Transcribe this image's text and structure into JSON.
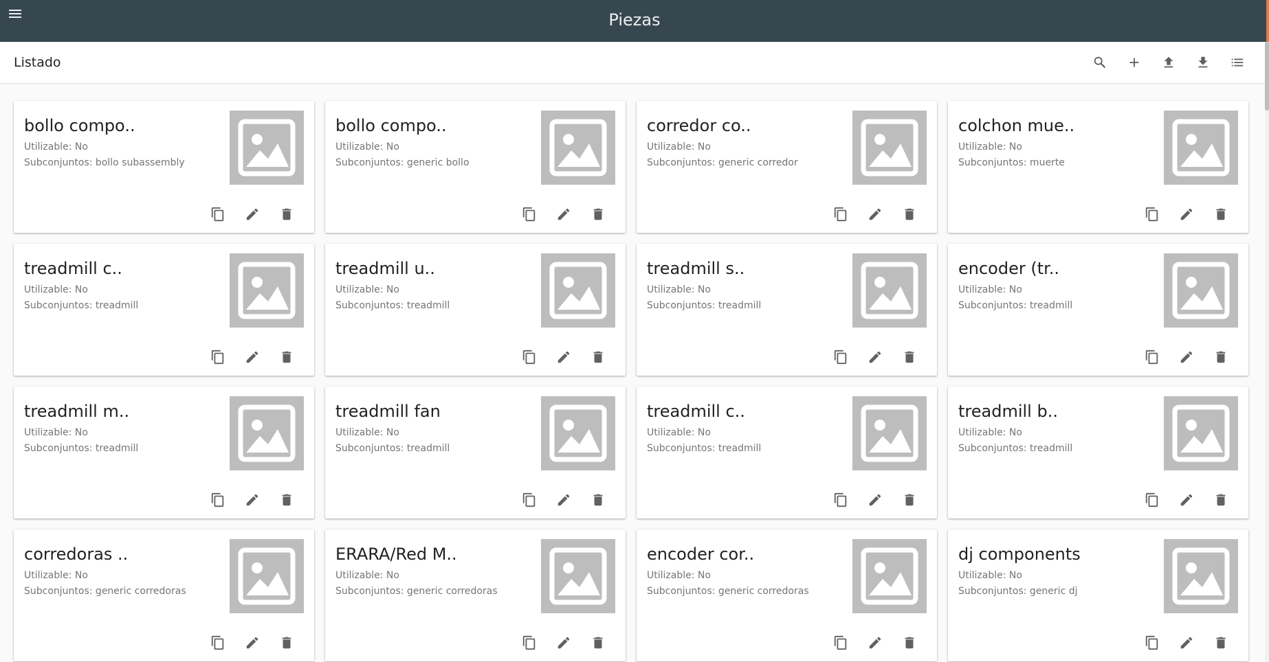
{
  "header": {
    "title": "Piezas",
    "menu_icon": "menu-icon"
  },
  "toolbar": {
    "title": "Listado",
    "actions": [
      "search-icon",
      "add-icon",
      "upload-icon",
      "download-icon",
      "list-icon"
    ]
  },
  "colors": {
    "header_bg": "#37474f",
    "accent": "#e07a4f",
    "placeholder": "#bdbdbd"
  },
  "cards": [
    {
      "title": "bollo compo..",
      "utilizable": "Utilizable: No",
      "subconjuntos": "Subconjuntos: bollo subassembly"
    },
    {
      "title": "bollo compo..",
      "utilizable": "Utilizable: No",
      "subconjuntos": "Subconjuntos: generic bollo"
    },
    {
      "title": "corredor co..",
      "utilizable": "Utilizable: No",
      "subconjuntos": "Subconjuntos: generic corredor"
    },
    {
      "title": "colchon mue..",
      "utilizable": "Utilizable: No",
      "subconjuntos": "Subconjuntos: muerte"
    },
    {
      "title": "treadmill c..",
      "utilizable": "Utilizable: No",
      "subconjuntos": "Subconjuntos: treadmill"
    },
    {
      "title": "treadmill u..",
      "utilizable": "Utilizable: No",
      "subconjuntos": "Subconjuntos: treadmill"
    },
    {
      "title": "treadmill s..",
      "utilizable": "Utilizable: No",
      "subconjuntos": "Subconjuntos: treadmill"
    },
    {
      "title": "encoder (tr..",
      "utilizable": "Utilizable: No",
      "subconjuntos": "Subconjuntos: treadmill"
    },
    {
      "title": "treadmill m..",
      "utilizable": "Utilizable: No",
      "subconjuntos": "Subconjuntos: treadmill"
    },
    {
      "title": "treadmill fan",
      "utilizable": "Utilizable: No",
      "subconjuntos": "Subconjuntos: treadmill"
    },
    {
      "title": "treadmill c..",
      "utilizable": "Utilizable: No",
      "subconjuntos": "Subconjuntos: treadmill"
    },
    {
      "title": "treadmill b..",
      "utilizable": "Utilizable: No",
      "subconjuntos": "Subconjuntos: treadmill"
    },
    {
      "title": "corredoras ..",
      "utilizable": "Utilizable: No",
      "subconjuntos": "Subconjuntos: generic corredoras"
    },
    {
      "title": "ERARA/Red M..",
      "utilizable": "Utilizable: No",
      "subconjuntos": "Subconjuntos: generic corredoras"
    },
    {
      "title": "encoder cor..",
      "utilizable": "Utilizable: No",
      "subconjuntos": "Subconjuntos: generic corredoras"
    },
    {
      "title": "dj components",
      "utilizable": "Utilizable: No",
      "subconjuntos": "Subconjuntos: generic dj"
    }
  ],
  "card_actions": [
    "copy-icon",
    "edit-icon",
    "delete-icon"
  ]
}
